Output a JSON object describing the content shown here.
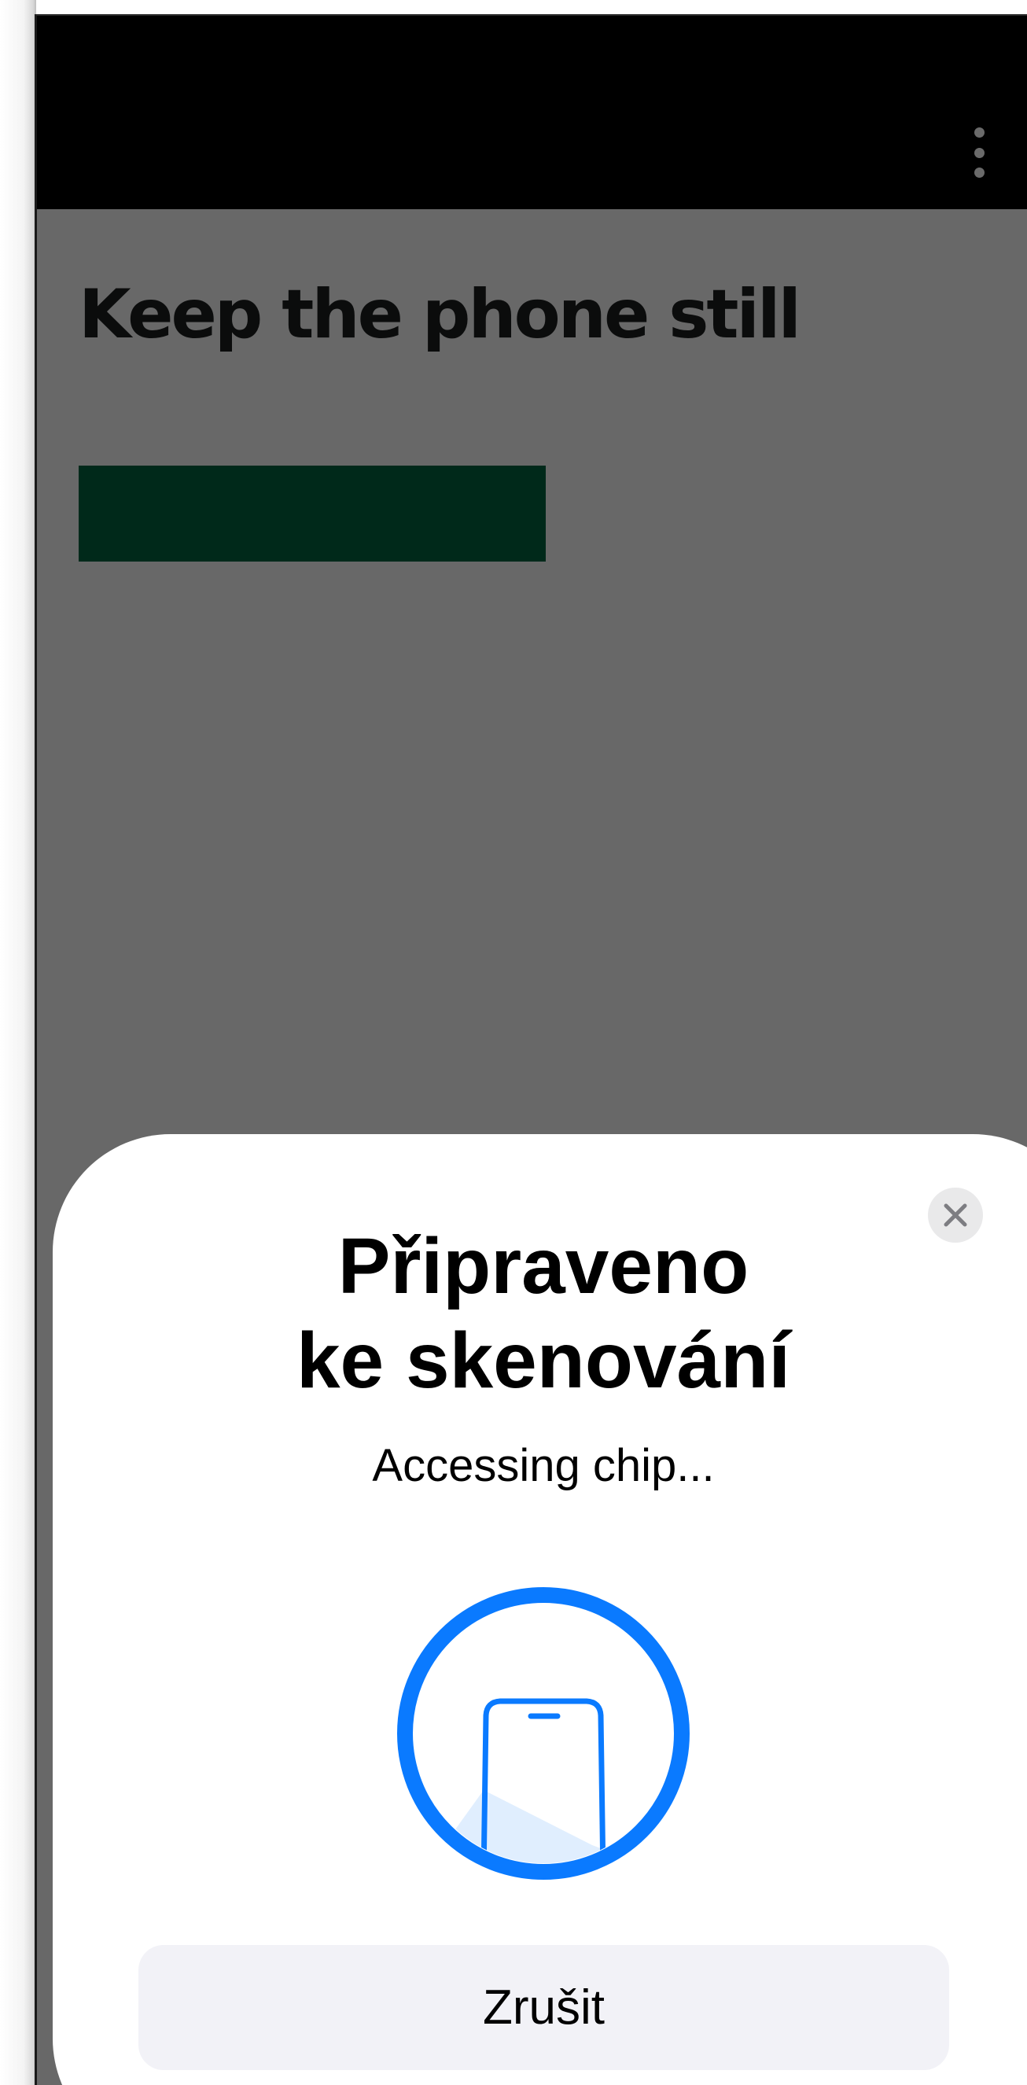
{
  "app_screen": {
    "page_title": "Keep the phone still",
    "menu_icon": "more-vertical-icon"
  },
  "scan_sheet": {
    "title_line1": "Připraveno",
    "title_line2": "ke skenování",
    "status_text": "Accessing chip...",
    "cancel_label": "Zrušit",
    "close_icon": "close-icon",
    "illustration_icon": "phone-scan-icon"
  },
  "colors": {
    "top_bar": "#000000",
    "dimmed_background": "#686868",
    "primary_button": "#00291a",
    "accent_blue": "#0a7aff",
    "sheet_background": "#ffffff",
    "cancel_button_background": "#f2f2f7"
  }
}
